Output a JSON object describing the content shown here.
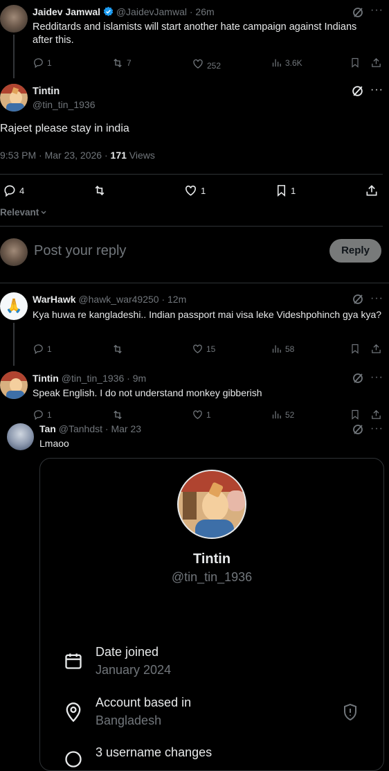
{
  "tweet1": {
    "name": "Jaidev Jamwal",
    "handle": "@JaidevJamwal",
    "time": "· 26m",
    "text": "Redditards and islamists will start another hate campaign against Indians after this.",
    "replies": "1",
    "reposts": "7",
    "likes": "252",
    "views": "3.6K"
  },
  "main": {
    "name": "Tintin",
    "handle": "@tin_tin_1936",
    "text": "Rajeet please stay in india",
    "meta_prefix": "9:53 PM · Mar 23, 2026 · ",
    "views_count": "171",
    "views_label": " Views",
    "replies": "4",
    "likes": "1",
    "bookmarks": "1",
    "sort_label": "Relevant"
  },
  "composer": {
    "placeholder": "Post your reply",
    "button": "Reply"
  },
  "reply1": {
    "name": "WarHawk",
    "handle": "@hawk_war49250",
    "time": "· 12m",
    "text": "Kya huwa re kangladeshi.. Indian passport mai visa leke Videshpohinch gya kya?",
    "replies": "1",
    "likes": "15",
    "views": "58"
  },
  "reply2": {
    "name": "Tintin",
    "handle": "@tin_tin_1936",
    "time": "· 9m",
    "text": "Speak English. I do not understand monkey gibberish",
    "replies": "1",
    "likes": "1",
    "views": "52"
  },
  "reply3": {
    "name": "Tan",
    "handle": "@Tanhdst",
    "time": "· Mar 23",
    "text": "Lmaoo"
  },
  "card": {
    "name": "Tintin",
    "handle": "@tin_tin_1936",
    "joined_label": "Date joined",
    "joined_value": "January 2024",
    "based_label": "Account based in",
    "based_value": "Bangladesh",
    "username_changes": "3 username changes"
  },
  "colors": {
    "bg": "#000000",
    "text": "#e7e9ea",
    "secondary": "#71767b",
    "verified": "#1d9bf0"
  }
}
